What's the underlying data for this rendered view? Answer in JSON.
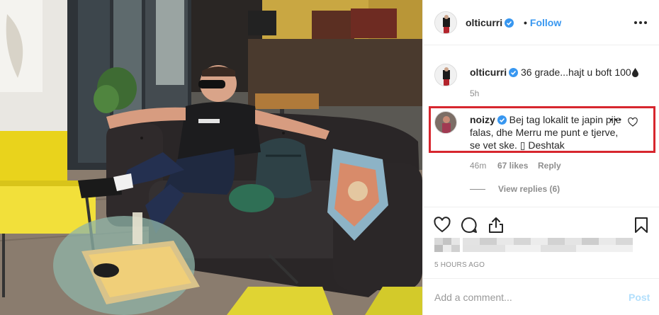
{
  "header": {
    "username": "olticurri",
    "separator": "•",
    "follow_label": "Follow",
    "more_icon": "more-horizontal-icon"
  },
  "caption": {
    "username": "olticurri",
    "text": "36 grade...hajt u boft 100",
    "emoji_icon": "droplet-icon",
    "time": "5h"
  },
  "comment": {
    "username": "noizy",
    "text": "Bej tag lokalit te japin pije falas, dhe Merru me punt e tjerve, se vet ske. ▯ Deshtak",
    "time": "46m",
    "likes": "67 likes",
    "reply_label": "Reply",
    "view_replies": "View replies (6)",
    "highlight_color": "#d7262e"
  },
  "actions": {
    "like_icon": "heart-icon",
    "comment_icon": "comment-bubble-icon",
    "share_icon": "share-icon",
    "save_icon": "bookmark-icon"
  },
  "posted_ago": "5 HOURS AGO",
  "add_comment": {
    "placeholder": "Add a comment...",
    "post_label": "Post"
  },
  "colors": {
    "link_blue": "#3897f0",
    "verified_blue": "#3897f0",
    "muted_text": "#8e8e8e",
    "disabled_post": "#b2dffc"
  }
}
